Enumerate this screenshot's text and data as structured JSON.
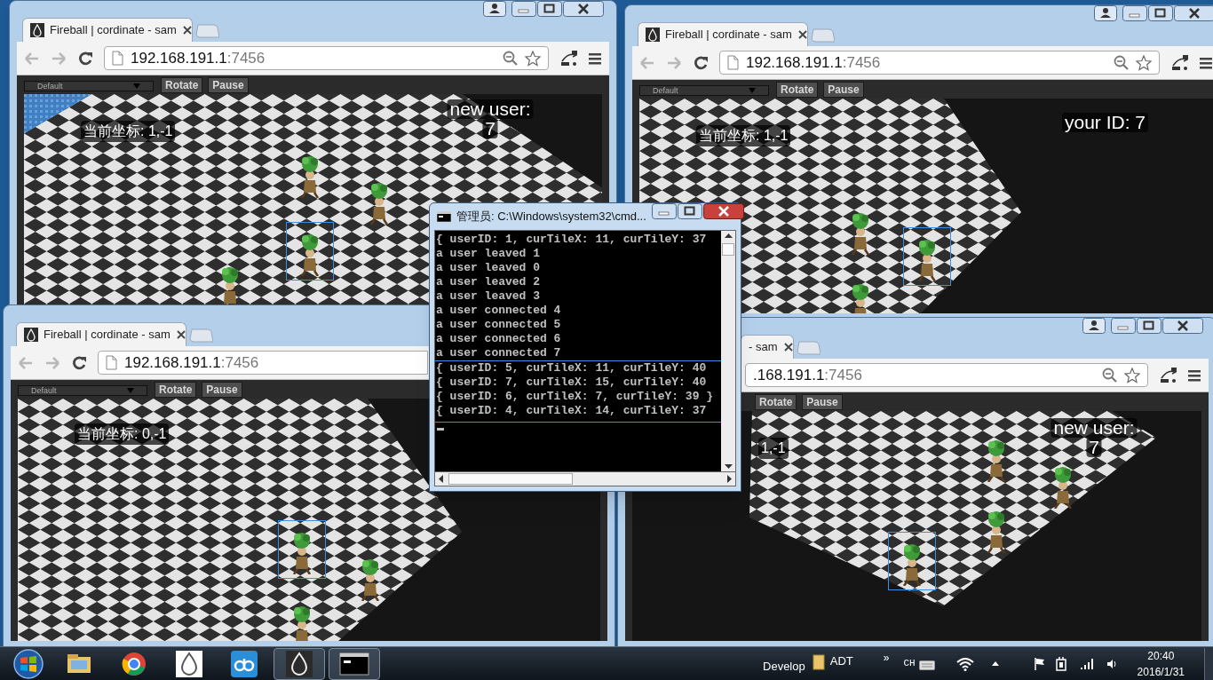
{
  "browser_windows": [
    {
      "tab_title": "Fireball | cordinate - sam",
      "url_host": "192.168.191.1",
      "url_port": ":7456",
      "dropdown": "Default",
      "buttons": [
        "Rotate",
        "Pause"
      ],
      "overlays": [
        {
          "kind": "coordinate",
          "text": "当前坐标: 1,-1"
        },
        {
          "kind": "message",
          "lines": [
            "new user:",
            "7"
          ]
        }
      ]
    },
    {
      "tab_title": "Fireball | cordinate - sam",
      "url_host": "192.168.191.1",
      "url_port": ":7456",
      "dropdown": "Default",
      "buttons": [
        "Rotate",
        "Pause"
      ],
      "overlays": [
        {
          "kind": "coordinate",
          "text": "当前坐标: 1,-1"
        },
        {
          "kind": "message",
          "lines": [
            "your ID: 7"
          ]
        }
      ]
    },
    {
      "tab_title": "Fireball | cordinate - sam",
      "url_host": "192.168.191.1",
      "url_port": ":7456",
      "dropdown": "Default",
      "buttons": [
        "Rotate",
        "Pause"
      ],
      "overlays": [
        {
          "kind": "coordinate",
          "text": "当前坐标: 0,-1"
        }
      ]
    },
    {
      "tab_title": "- sam",
      "url_host": ".168.191.1",
      "url_port": ":7456",
      "buttons": [
        "Rotate",
        "Pause"
      ],
      "overlays": [
        {
          "kind": "coordinate",
          "text": "1,-1"
        },
        {
          "kind": "message",
          "lines": [
            "new user:",
            "7"
          ]
        }
      ]
    }
  ],
  "console": {
    "title": "管理员: C:\\Windows\\system32\\cmd...",
    "lines": [
      {
        "text": "{ userID: 1, curTileX: 11, curTileY: 37",
        "selected": false
      },
      {
        "text": "a user leaved 1",
        "selected": false
      },
      {
        "text": "a user leaved 0",
        "selected": false
      },
      {
        "text": "a user leaved 2",
        "selected": false
      },
      {
        "text": "a user leaved 3",
        "selected": false
      },
      {
        "text": "a user connected 4",
        "selected": false
      },
      {
        "text": "a user connected 5",
        "selected": false
      },
      {
        "text": "a user connected 6",
        "selected": false
      },
      {
        "text": "a user connected 7",
        "selected": false
      },
      {
        "text": "{ userID: 5, curTileX: 11, curTileY: 40",
        "selected": true
      },
      {
        "text": "{ userID: 7, curTileX: 15, curTileY: 40",
        "selected": true
      },
      {
        "text": "{ userID: 6, curTileX: 7, curTileY: 39 }",
        "selected": true
      },
      {
        "text": "{ userID: 4, curTileX: 14, curTileY: 37",
        "selected": true
      }
    ]
  },
  "taskbar": {
    "toolbars": [
      "Develop",
      "ADT"
    ],
    "chevron": "»",
    "input_language": "CH",
    "time": "20:40",
    "date": "2016/1/31"
  }
}
